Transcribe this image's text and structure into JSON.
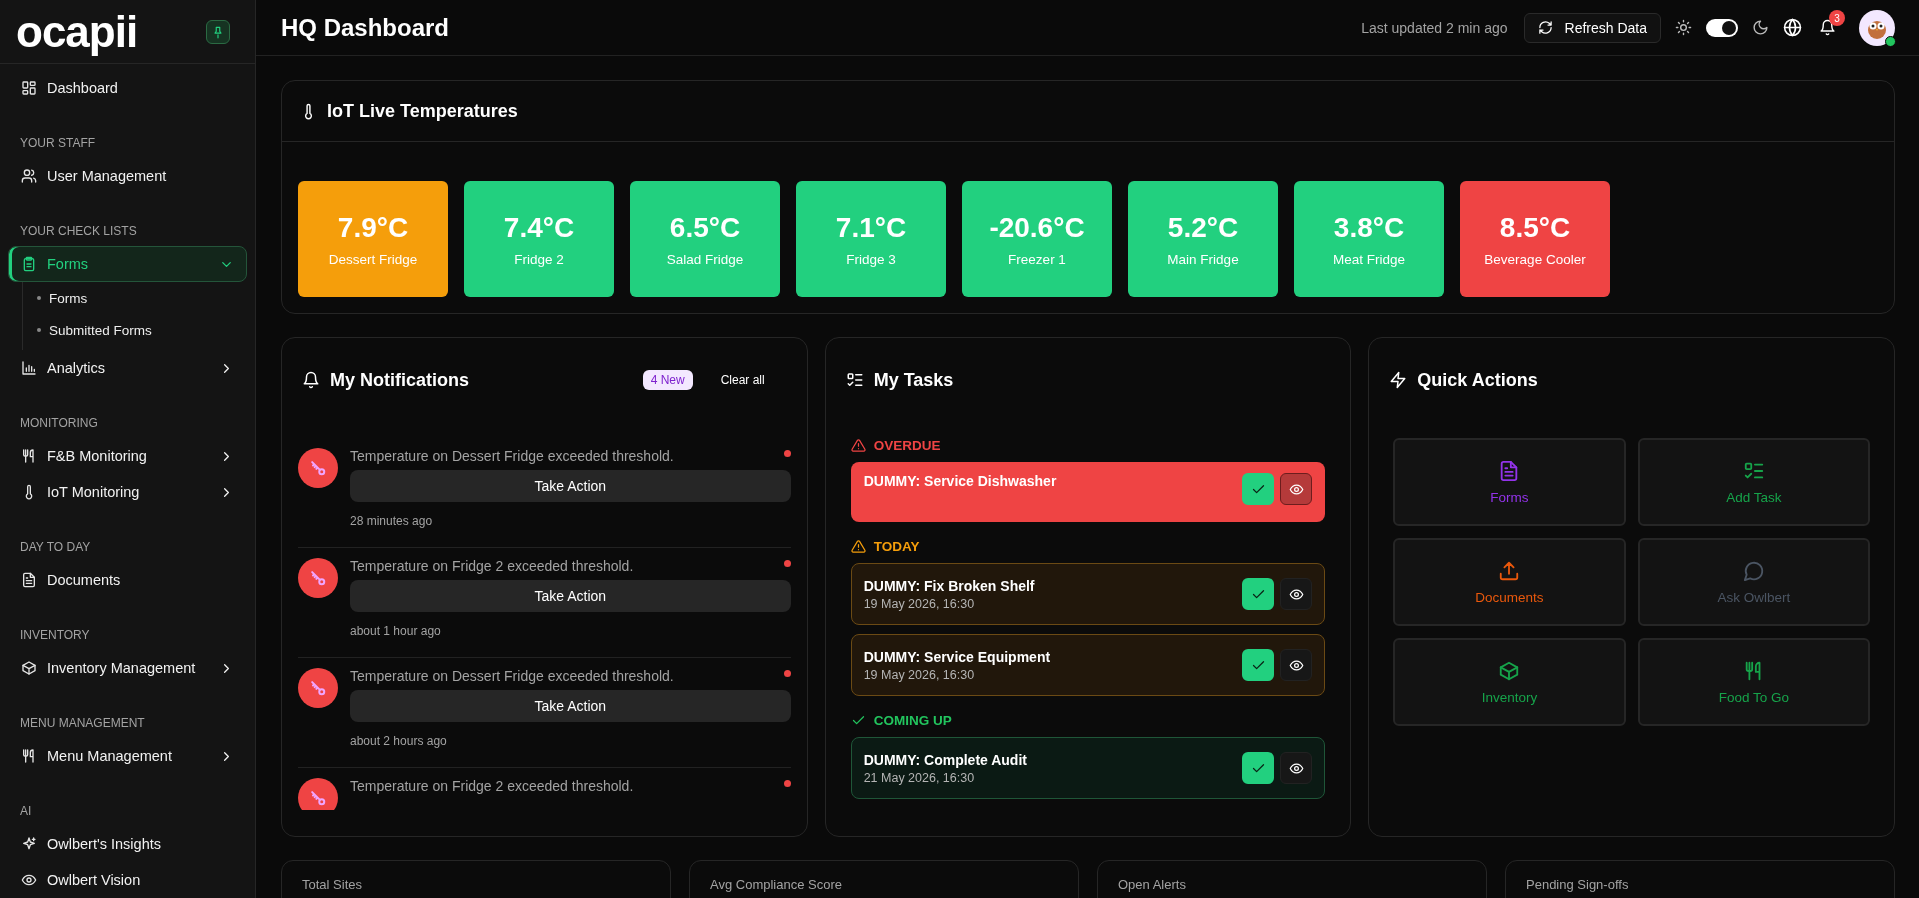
{
  "sidebar": {
    "logo": "ocapii",
    "pinned": true,
    "sections": [
      {
        "items": [
          {
            "label": "Dashboard",
            "selected": false
          }
        ]
      },
      {
        "heading": "YOUR STAFF",
        "items": [
          {
            "label": "User Management",
            "selected": false
          }
        ]
      },
      {
        "heading": "YOUR CHECK LISTS",
        "items": [
          {
            "label": "Forms",
            "selected": true,
            "expanded": true,
            "children": [
              {
                "label": "Forms"
              },
              {
                "label": "Submitted Forms"
              }
            ]
          },
          {
            "label": "Analytics",
            "selected": false,
            "expanded": false
          }
        ]
      },
      {
        "heading": "MONITORING",
        "items": [
          {
            "label": "F&B Monitoring",
            "selected": false,
            "expanded": false
          },
          {
            "label": "IoT Monitoring",
            "selected": false,
            "expanded": false
          }
        ]
      },
      {
        "heading": "DAY TO DAY",
        "items": [
          {
            "label": "Documents",
            "selected": false
          }
        ]
      },
      {
        "heading": "INVENTORY",
        "items": [
          {
            "label": "Inventory Management",
            "selected": false,
            "expanded": false
          }
        ]
      },
      {
        "heading": "MENU MANAGEMENT",
        "items": [
          {
            "label": "Menu Management",
            "selected": false,
            "expanded": false
          }
        ]
      },
      {
        "heading": "AI",
        "items": [
          {
            "label": "Owlbert's Insights",
            "selected": false
          },
          {
            "label": "Owlbert Vision",
            "selected": false
          }
        ]
      }
    ]
  },
  "header": {
    "title": "HQ Dashboard",
    "last_updated": "Last updated 2 min ago",
    "refresh_button": "Refresh Data",
    "dark_mode": true,
    "notification_count": "3",
    "user_online": true
  },
  "iot": {
    "title": "IoT Live Temperatures",
    "sensors": [
      {
        "temperature": "7.9°C",
        "name": "Dessert Fridge",
        "color": "#f59e0b"
      },
      {
        "temperature": "7.4°C",
        "name": "Fridge 2",
        "color": "#22d07f"
      },
      {
        "temperature": "6.5°C",
        "name": "Salad Fridge",
        "color": "#22d07f"
      },
      {
        "temperature": "7.1°C",
        "name": "Fridge 3",
        "color": "#22d07f"
      },
      {
        "temperature": "-20.6°C",
        "name": "Freezer 1",
        "color": "#22d07f"
      },
      {
        "temperature": "5.2°C",
        "name": "Main Fridge",
        "color": "#22d07f"
      },
      {
        "temperature": "3.8°C",
        "name": "Meat Fridge",
        "color": "#22d07f"
      },
      {
        "temperature": "8.5°C",
        "name": "Beverage Cooler",
        "color": "#ef4444"
      }
    ]
  },
  "notifications": {
    "title": "My Notifications",
    "new_badge": "4 New",
    "clear_button": "Clear all",
    "items": [
      {
        "message": "Temperature on Dessert Fridge exceeded threshold.",
        "action": "Take Action",
        "time": "28 minutes ago",
        "unread": true
      },
      {
        "message": "Temperature on Fridge 2 exceeded threshold.",
        "action": "Take Action",
        "time": "about 1 hour ago",
        "unread": true
      },
      {
        "message": "Temperature on Dessert Fridge exceeded threshold.",
        "action": "Take Action",
        "time": "about 2 hours ago",
        "unread": true
      },
      {
        "message": "Temperature on Fridge 2 exceeded threshold.",
        "unread": true
      }
    ]
  },
  "tasks": {
    "title": "My Tasks",
    "groups": [
      {
        "kind": "overdue",
        "label": "OVERDUE",
        "tasks": [
          {
            "title": "DUMMY: Service Dishwasher"
          }
        ]
      },
      {
        "kind": "today",
        "label": "TODAY",
        "tasks": [
          {
            "title": "DUMMY: Fix Broken Shelf",
            "due": "19 May 2026, 16:30"
          },
          {
            "title": "DUMMY: Service Equipment",
            "due": "19 May 2026, 16:30"
          }
        ]
      },
      {
        "kind": "upcoming",
        "label": "COMING UP",
        "tasks": [
          {
            "title": "DUMMY: Complete Audit",
            "due": "21 May 2026, 16:30"
          }
        ]
      }
    ]
  },
  "quick_actions": {
    "title": "Quick Actions",
    "actions": [
      {
        "label": "Forms",
        "color": "#9333ea"
      },
      {
        "label": "Add Task",
        "color": "#16a34a"
      },
      {
        "label": "Documents",
        "color": "#ea580c"
      },
      {
        "label": "Ask Owlbert",
        "color": "#4b5563"
      },
      {
        "label": "Inventory",
        "color": "#16a34a"
      },
      {
        "label": "Food To Go",
        "color": "#16a34a"
      }
    ]
  },
  "stats": [
    {
      "label": "Total Sites"
    },
    {
      "label": "Avg Compliance Score"
    },
    {
      "label": "Open Alerts"
    },
    {
      "label": "Pending Sign-offs"
    }
  ]
}
